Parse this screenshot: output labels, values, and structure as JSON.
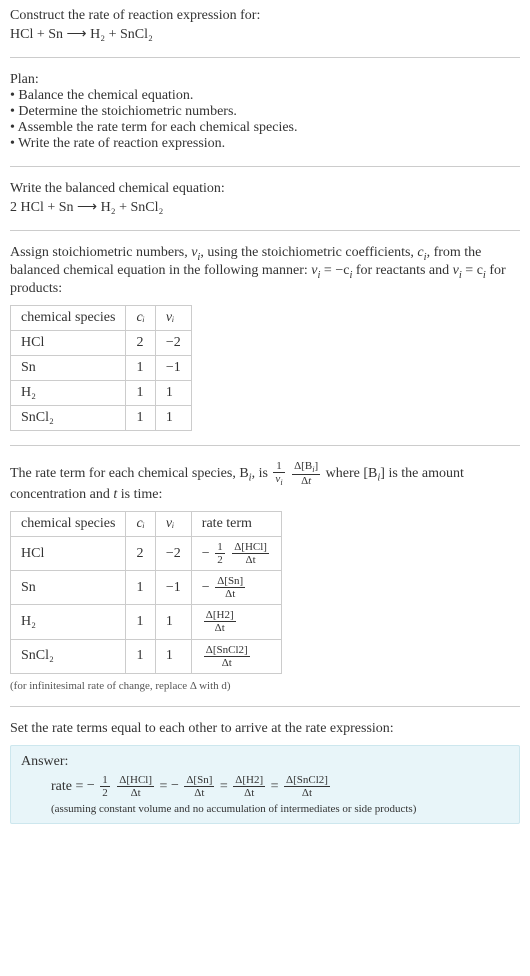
{
  "intro": {
    "line1": "Construct the rate of reaction expression for:",
    "equation": "HCl + Sn ⟶ H₂ + SnCl₂"
  },
  "plan": {
    "heading": "Plan:",
    "b1": "• Balance the chemical equation.",
    "b2": "• Determine the stoichiometric numbers.",
    "b3": "• Assemble the rate term for each chemical species.",
    "b4": "• Write the rate of reaction expression."
  },
  "balanced": {
    "line": "Write the balanced chemical equation:",
    "equation": "2 HCl + Sn ⟶ H₂ + SnCl₂"
  },
  "assign": {
    "text_before": "Assign stoichiometric numbers, ",
    "nu_i": "ν",
    "text_mid1": ", using the stoichiometric coefficients, ",
    "c_i": "c",
    "text_mid2": ", from the balanced chemical equation in the following manner: ",
    "rel_reactants_pre": "ν",
    "rel_reactants_mid": " = −c",
    "rel_reactants_post": " for reactants and ",
    "rel_products_pre": "ν",
    "rel_products_mid": " = c",
    "rel_products_post": " for products:"
  },
  "table1": {
    "h0": "chemical species",
    "h1": "cᵢ",
    "h2": "νᵢ",
    "rows": [
      {
        "species": "HCl",
        "c": "2",
        "nu": "−2"
      },
      {
        "species": "Sn",
        "c": "1",
        "nu": "−1"
      },
      {
        "species": "H₂",
        "c": "1",
        "nu": "1"
      },
      {
        "species": "SnCl₂",
        "c": "1",
        "nu": "1"
      }
    ]
  },
  "rateterm": {
    "pre": "The rate term for each chemical species, B",
    "mid1": ", is ",
    "mid2": " where [B",
    "mid3": "] is the amount concentration and ",
    "t": "t",
    "post": " is time:"
  },
  "table2": {
    "h0": "chemical species",
    "h1": "cᵢ",
    "h2": "νᵢ",
    "h3": "rate term",
    "rows": [
      {
        "species": "HCl",
        "c": "2",
        "nu": "−2",
        "neg": "−",
        "coef_num": "1",
        "coef_den": "2",
        "delta": "Δ[HCl]",
        "dt": "Δt"
      },
      {
        "species": "Sn",
        "c": "1",
        "nu": "−1",
        "neg": "−",
        "coef_num": "",
        "coef_den": "",
        "delta": "Δ[Sn]",
        "dt": "Δt"
      },
      {
        "species": "H₂",
        "c": "1",
        "nu": "1",
        "neg": "",
        "coef_num": "",
        "coef_den": "",
        "delta": "Δ[H2]",
        "dt": "Δt"
      },
      {
        "species": "SnCl₂",
        "c": "1",
        "nu": "1",
        "neg": "",
        "coef_num": "",
        "coef_den": "",
        "delta": "Δ[SnCl2]",
        "dt": "Δt"
      }
    ]
  },
  "footnote": "(for infinitesimal rate of change, replace Δ with d)",
  "final": {
    "line": "Set the rate terms equal to each other to arrive at the rate expression:"
  },
  "answer": {
    "heading": "Answer:",
    "rate_label": "rate = ",
    "neg": "−",
    "half_num": "1",
    "half_den": "2",
    "d_hcl": "Δ[HCl]",
    "d_sn": "Δ[Sn]",
    "d_h2": "Δ[H2]",
    "d_sncl2": "Δ[SnCl2]",
    "dt": "Δt",
    "eq": " = ",
    "note": "(assuming constant volume and no accumulation of intermediates or side products)"
  }
}
